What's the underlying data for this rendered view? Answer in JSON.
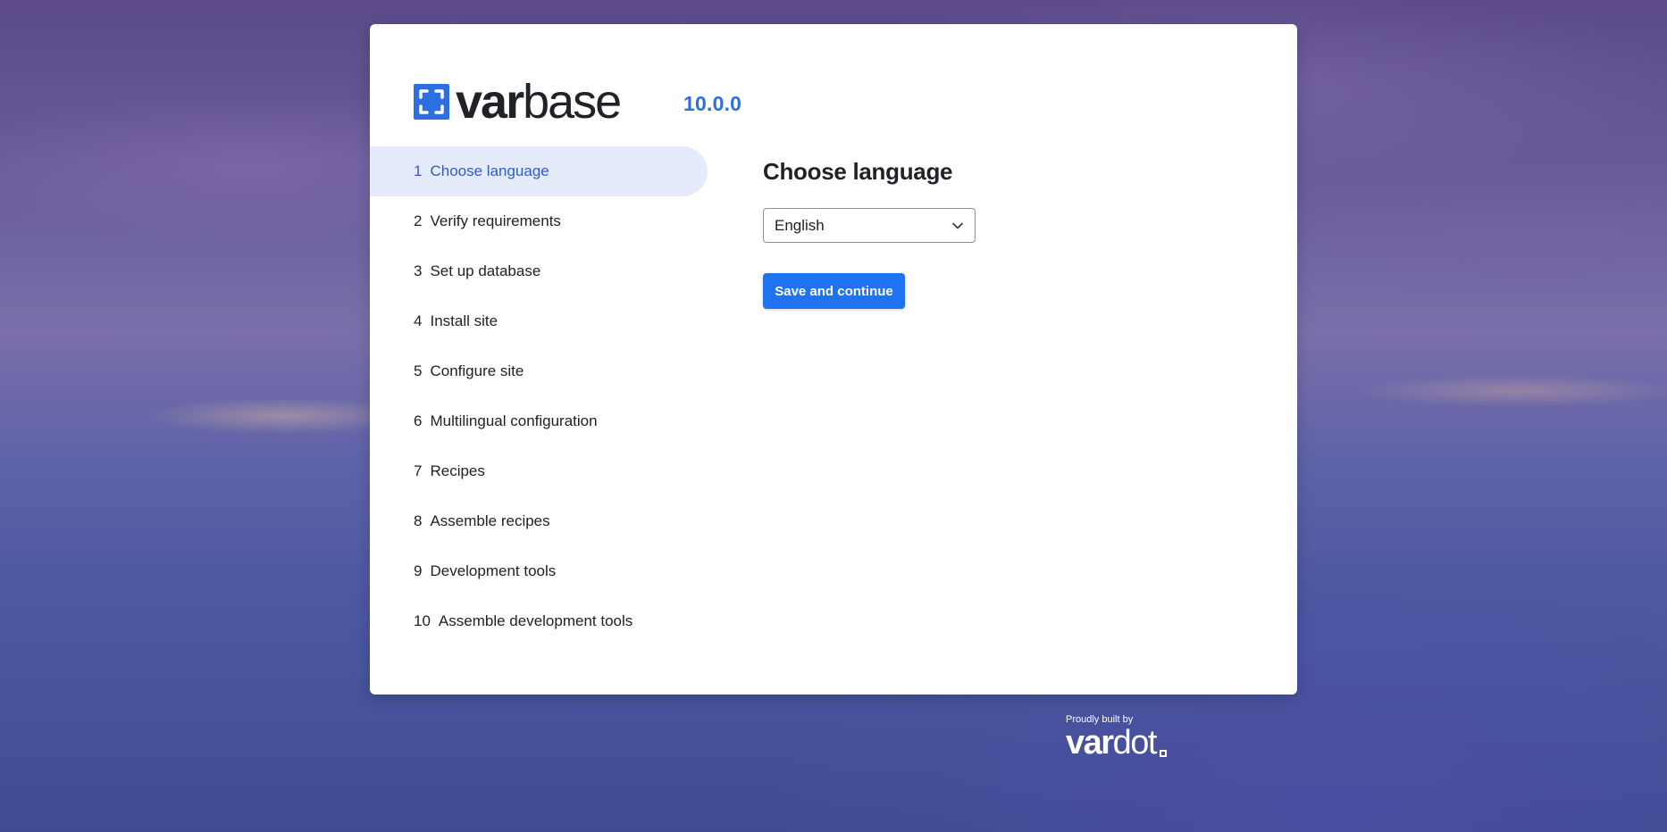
{
  "brand": {
    "logo_bold": "var",
    "logo_light": "base",
    "version": "10.0.0"
  },
  "steps": [
    {
      "number": "1",
      "label": "Choose language",
      "active": true
    },
    {
      "number": "2",
      "label": "Verify requirements"
    },
    {
      "number": "3",
      "label": "Set up database"
    },
    {
      "number": "4",
      "label": "Install site"
    },
    {
      "number": "5",
      "label": "Configure site"
    },
    {
      "number": "6",
      "label": "Multilingual configuration"
    },
    {
      "number": "7",
      "label": "Recipes"
    },
    {
      "number": "8",
      "label": "Assemble recipes"
    },
    {
      "number": "9",
      "label": "Development tools"
    },
    {
      "number": "10",
      "label": "Assemble development tools"
    }
  ],
  "main": {
    "heading": "Choose language",
    "language_select": {
      "selected": "English"
    },
    "submit_label": "Save and continue"
  },
  "footer": {
    "built_by": "Proudly built by",
    "vendor_bold": "var",
    "vendor_light": "dot"
  },
  "colors": {
    "accent": "#2e6fe0",
    "button": "#1f73f1",
    "active_step_bg": "#e5ebfb"
  }
}
